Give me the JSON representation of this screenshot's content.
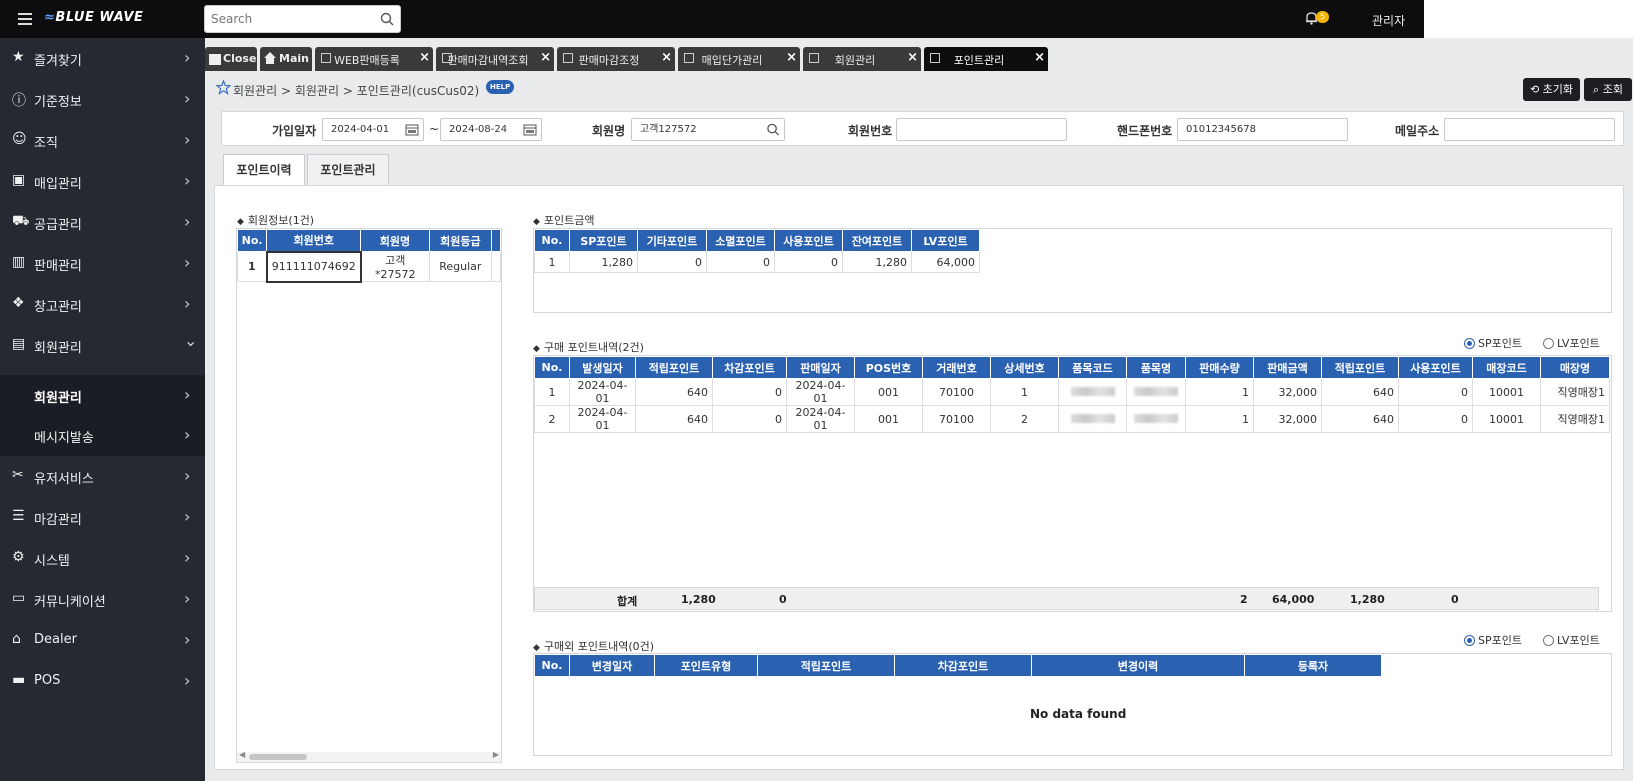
{
  "app": {
    "logo": "BLUE WAVE",
    "search_placeholder": "Search",
    "notif_count": "5",
    "user": "관리자"
  },
  "sidebar": {
    "items": [
      {
        "label": "즐겨찾기",
        "icon": "star-icon"
      },
      {
        "label": "기준정보",
        "icon": "info-icon"
      },
      {
        "label": "조직",
        "icon": "users-icon"
      },
      {
        "label": "매입관리",
        "icon": "box-icon"
      },
      {
        "label": "공급관리",
        "icon": "truck-icon"
      },
      {
        "label": "판매관리",
        "icon": "scan-icon"
      },
      {
        "label": "창고관리",
        "icon": "boxes-icon"
      },
      {
        "label": "회원관리",
        "icon": "idcard-icon"
      },
      {
        "label": "회원관리",
        "icon": "",
        "sub": true
      },
      {
        "label": "메시지발송",
        "icon": "",
        "sub": true
      },
      {
        "label": "유저서비스",
        "icon": "tools-icon"
      },
      {
        "label": "마감관리",
        "icon": "sliders-icon"
      },
      {
        "label": "시스템",
        "icon": "gear-icon"
      },
      {
        "label": "커뮤니케이션",
        "icon": "chat-icon"
      },
      {
        "label": "Dealer",
        "icon": "store-icon"
      },
      {
        "label": "POS",
        "icon": "monitor-icon"
      }
    ]
  },
  "tabs": [
    {
      "label": "Close"
    },
    {
      "label": "Main"
    },
    {
      "label": "WEB판매등록"
    },
    {
      "label": "판매마감내역조회"
    },
    {
      "label": "판매마감조정"
    },
    {
      "label": "매입단가관리"
    },
    {
      "label": "회원관리"
    },
    {
      "label": "포인트관리"
    }
  ],
  "breadcrumb": "회원관리 > 회원관리 > 포인트관리(cusCus02)",
  "help": "HELP",
  "buttons": {
    "reset": "초기화",
    "search": "조회"
  },
  "filter": {
    "join_date_label": "가입일자",
    "date_from": "2024-04-01",
    "date_sep": "~",
    "date_to": "2024-08-24",
    "member_name_label": "회원명",
    "member_name": "고객127572",
    "member_no_label": "회원번호",
    "member_no": "",
    "phone_label": "핸드폰번호",
    "phone": "01012345678",
    "email_label": "메일주소",
    "email": ""
  },
  "inner_tabs": [
    "포인트이력",
    "포인트관리"
  ],
  "member": {
    "title": "회원정보(1건)",
    "headers": [
      "No.",
      "회원번호",
      "회원명",
      "회원등급"
    ],
    "rows": [
      [
        "1",
        "911111074692",
        "고객*27572",
        "Regular"
      ]
    ]
  },
  "points": {
    "title": "포인트금액",
    "headers": [
      "No.",
      "SP포인트",
      "기타포인트",
      "소멸포인트",
      "사용포인트",
      "잔여포인트",
      "LV포인트"
    ],
    "rows": [
      [
        "1",
        "1,280",
        "0",
        "0",
        "0",
        "1,280",
        "64,000"
      ]
    ]
  },
  "purchase": {
    "title": "구매 포인트내역(2건)",
    "radio_sp": "SP포인트",
    "radio_lv": "LV포인트",
    "headers": [
      "No.",
      "발생일자",
      "적립포인트",
      "차감포인트",
      "판매일자",
      "POS번호",
      "거래번호",
      "상세번호",
      "품목코드",
      "품목명",
      "판매수량",
      "판매금액",
      "적립포인트",
      "사용포인트",
      "매장코드",
      "매장명"
    ],
    "rows": [
      [
        "1",
        "2024-04-01",
        "640",
        "0",
        "2024-04-01",
        "001",
        "70100",
        "1",
        "",
        "",
        "1",
        "32,000",
        "640",
        "0",
        "10001",
        "직영매장1"
      ],
      [
        "2",
        "2024-04-01",
        "640",
        "0",
        "2024-04-01",
        "001",
        "70100",
        "2",
        "",
        "",
        "1",
        "32,000",
        "640",
        "0",
        "10001",
        "직영매장1"
      ]
    ],
    "total": {
      "label": "합계",
      "earn": "1,280",
      "deduct": "0",
      "qty": "2",
      "amount": "64,000",
      "earn2": "1,280",
      "used": "0"
    }
  },
  "other": {
    "title": "구매외 포인트내역(0건)",
    "radio_sp": "SP포인트",
    "radio_lv": "LV포인트",
    "headers": [
      "No.",
      "변경일자",
      "포인트유형",
      "적립포인트",
      "차감포인트",
      "변경이력",
      "등록자"
    ],
    "empty": "No data found"
  }
}
